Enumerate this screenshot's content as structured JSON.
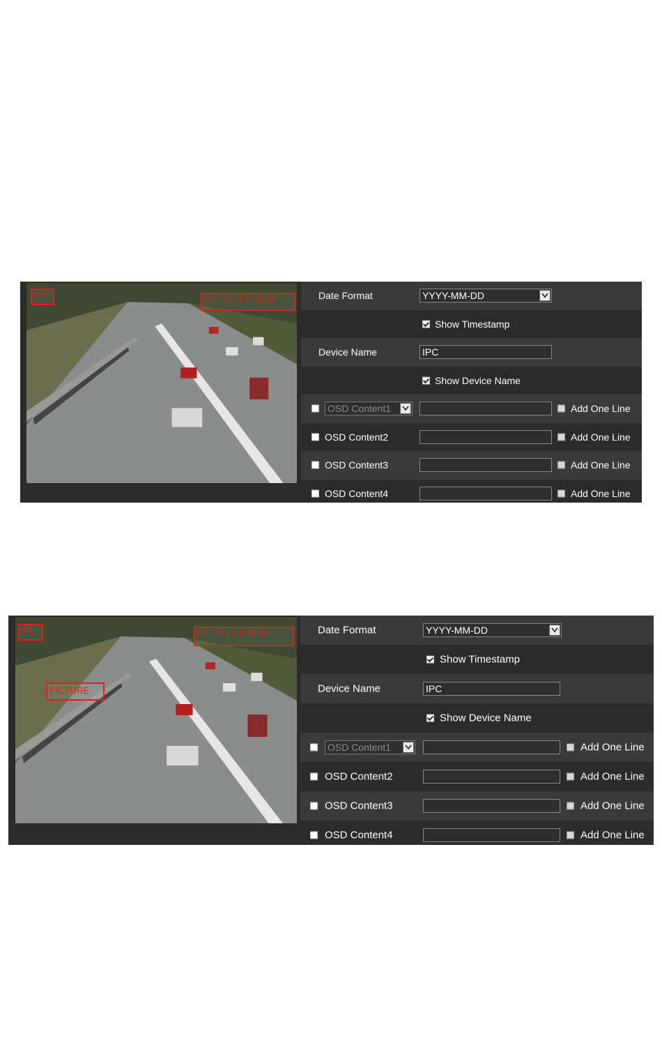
{
  "panels": [
    {
      "overlays": {
        "device": "IPC",
        "timestamp": "2017-07-14 11:58:18",
        "picture": ""
      },
      "date_format_label": "Date Format",
      "date_format_value": "YYYY-MM-DD",
      "show_timestamp_label": "Show Timestamp",
      "device_name_label": "Device Name",
      "device_name_value": "IPC",
      "show_device_name_label": "Show Device Name",
      "osd1_select": "OSD Content1",
      "osd2_label": "OSD Content2",
      "osd3_label": "OSD Content3",
      "osd4_label": "OSD Content4",
      "add_one_line": "Add One Line"
    },
    {
      "overlays": {
        "device": "IPC",
        "timestamp": "2017-07-14 11:58:18",
        "picture": "PICTURE"
      },
      "date_format_label": "Date Format",
      "date_format_value": "YYYY-MM-DD",
      "show_timestamp_label": "Show Timestamp",
      "device_name_label": "Device Name",
      "device_name_value": "IPC",
      "show_device_name_label": "Show Device Name",
      "osd1_select": "OSD Content1",
      "osd2_label": "OSD Content2",
      "osd3_label": "OSD Content3",
      "osd4_label": "OSD Content4",
      "add_one_line": "Add One Line"
    }
  ],
  "colors": {
    "panel_bg": "#2b2b2b",
    "row_alt": "#3a3a3a",
    "osd_red": "#e0201a",
    "text": "#ffffff"
  },
  "icons": {
    "dropdown": "chevron-down-icon",
    "checkbox": "checkbox-icon"
  }
}
